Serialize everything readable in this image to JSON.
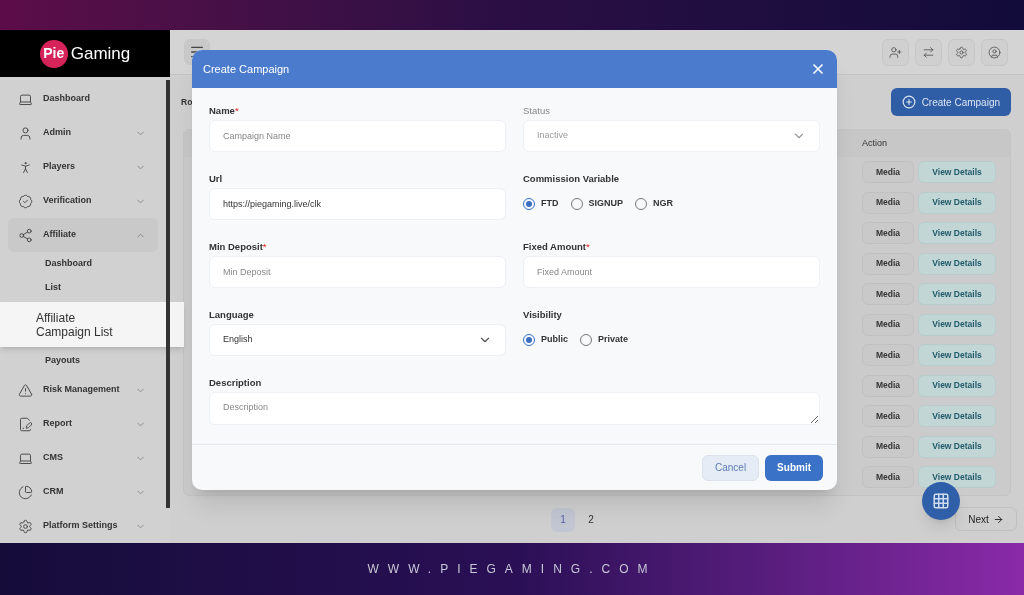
{
  "brand": {
    "badge": "Pie",
    "name": "Gaming"
  },
  "sidebar": {
    "items": [
      {
        "kind": "link",
        "label": "Dashboard"
      },
      {
        "kind": "group",
        "label": "Admin",
        "expanded": false
      },
      {
        "kind": "group",
        "label": "Players",
        "expanded": false
      },
      {
        "kind": "group",
        "label": "Verification",
        "expanded": false
      },
      {
        "kind": "group",
        "label": "Affiliate",
        "expanded": true,
        "children": [
          {
            "label": "Dashboard",
            "selected": false
          },
          {
            "label": "List",
            "selected": false
          },
          {
            "label": "Affiliate Campaign List",
            "selected": true
          },
          {
            "label": "Payouts",
            "selected": false
          }
        ]
      },
      {
        "kind": "group",
        "label": "Risk Management",
        "expanded": false
      },
      {
        "kind": "group",
        "label": "Report",
        "expanded": false
      },
      {
        "kind": "group",
        "label": "CMS",
        "expanded": false
      },
      {
        "kind": "group",
        "label": "CRM",
        "expanded": false
      },
      {
        "kind": "group",
        "label": "Platform Settings",
        "expanded": false
      }
    ]
  },
  "toolbar": {
    "cut_label": "Ro",
    "create_button": "Create Campaign"
  },
  "table": {
    "columns": [
      "Action"
    ],
    "rows": [
      [
        "Media",
        "View Details"
      ],
      [
        "Media",
        "View Details"
      ],
      [
        "Media",
        "View Details"
      ],
      [
        "Media",
        "View Details"
      ],
      [
        "Media",
        "View Details"
      ],
      [
        "Media",
        "View Details"
      ],
      [
        "Media",
        "View Details"
      ],
      [
        "Media",
        "View Details"
      ],
      [
        "Media",
        "View Details"
      ],
      [
        "Media",
        "View Details"
      ],
      [
        "Media",
        "View Details"
      ]
    ]
  },
  "pagination": {
    "pages": [
      {
        "label": "1",
        "selected": true
      },
      {
        "label": "2",
        "selected": false
      }
    ],
    "next": "Next"
  },
  "modal": {
    "title": "Create Campaign",
    "fields": [
      {
        "kind": "text",
        "label": "Name",
        "required_mark": "*",
        "disabled": false,
        "placeholder": "Campaign Name"
      },
      {
        "kind": "select",
        "label": "Status",
        "disabled": true,
        "value": "Inactive"
      },
      {
        "kind": "text",
        "label": "Url",
        "disabled": false,
        "value": "https://piegaming.live/clk"
      },
      {
        "kind": "radio",
        "label": "Commission Variable",
        "disabled": false,
        "options": [
          {
            "label": "FTD",
            "selected": true
          },
          {
            "label": "SIGNUP",
            "selected": false
          },
          {
            "label": "NGR",
            "selected": false
          }
        ]
      },
      {
        "kind": "text",
        "label": "Min Deposit",
        "required_mark": "*",
        "disabled": false,
        "placeholder": "Min Deposit"
      },
      {
        "kind": "text",
        "label": "Fixed Amount",
        "required_mark": "*",
        "disabled": false,
        "placeholder": "Fixed Amount"
      },
      {
        "kind": "select",
        "label": "Language",
        "disabled": false,
        "value": "English"
      },
      {
        "kind": "radio",
        "label": "Visibility",
        "disabled": false,
        "options": [
          {
            "label": "Public",
            "selected": true
          },
          {
            "label": "Private",
            "selected": false
          }
        ]
      },
      {
        "kind": "textarea",
        "label": "Description",
        "disabled": false,
        "placeholder": "Description"
      }
    ],
    "buttons": [
      {
        "kind": "secondary",
        "label": "Cancel"
      },
      {
        "kind": "primary",
        "label": "Submit"
      }
    ]
  },
  "banner": {
    "url": "WWW.PIEGAMING.COM"
  }
}
